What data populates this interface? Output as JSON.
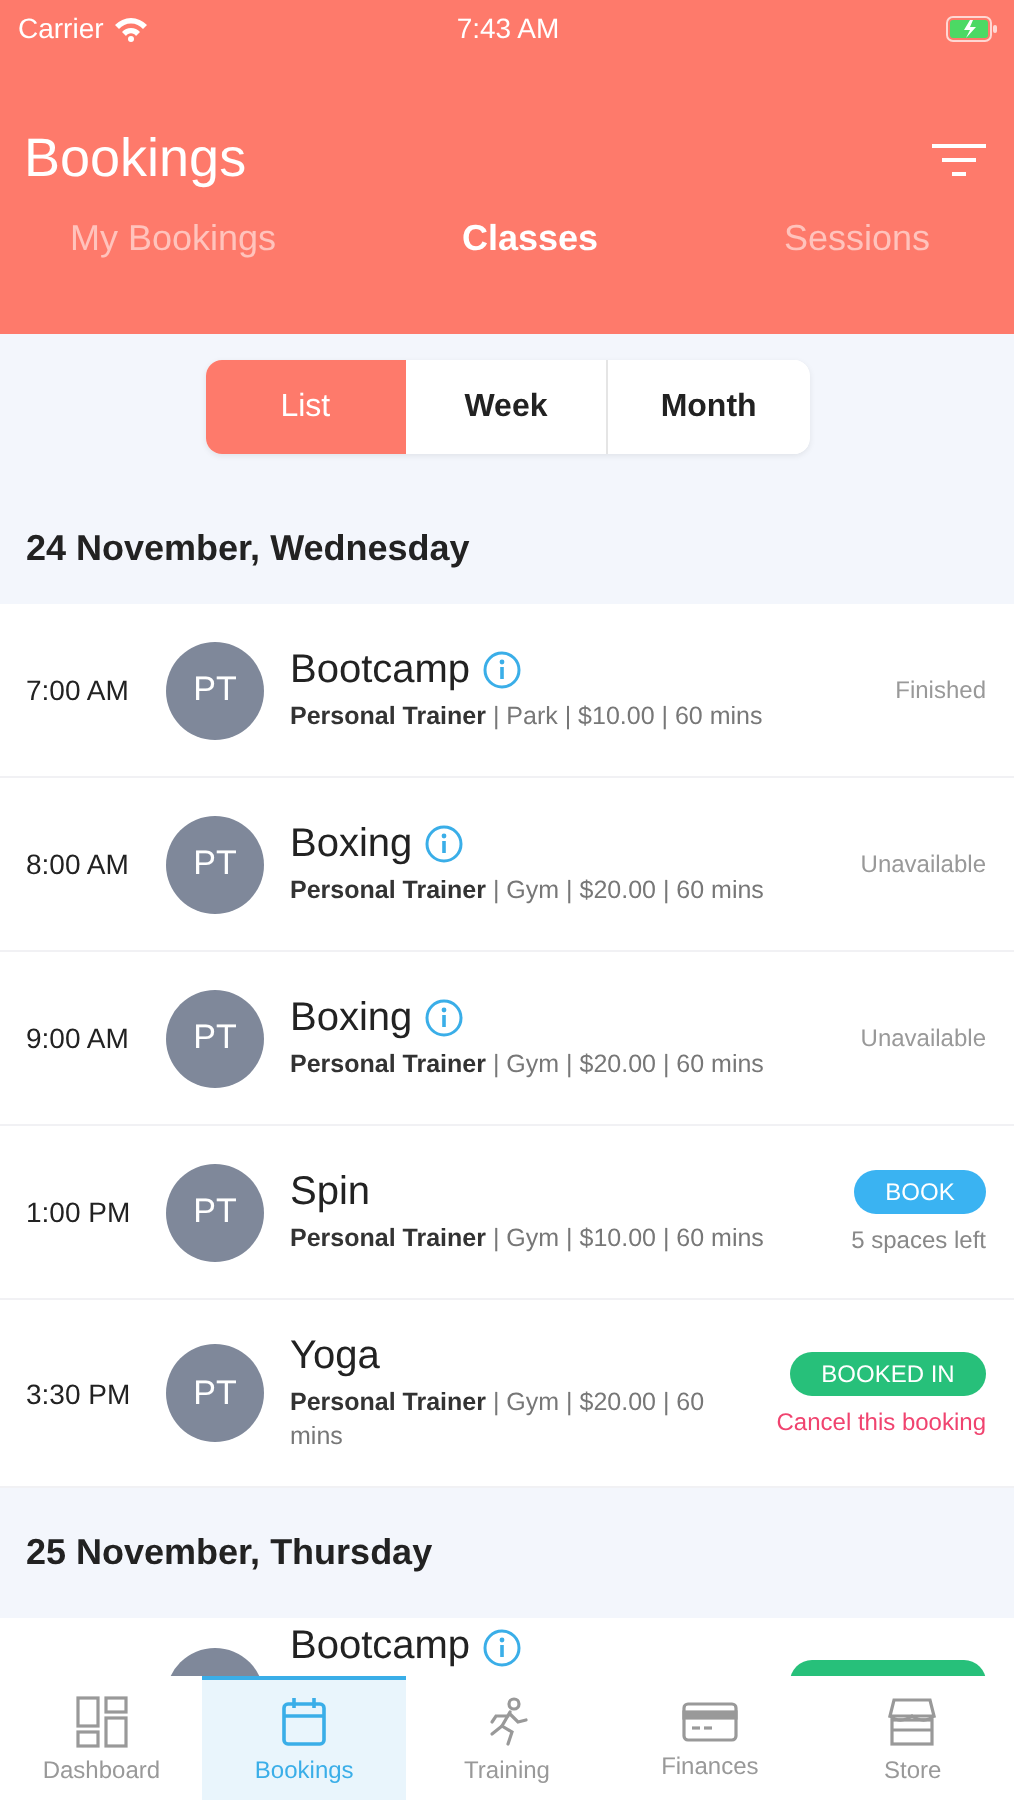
{
  "status_bar": {
    "carrier": "Carrier",
    "time": "7:43 AM"
  },
  "header": {
    "title": "Bookings"
  },
  "tabs": [
    {
      "label": "My Bookings",
      "selected": false
    },
    {
      "label": "Classes",
      "selected": true
    },
    {
      "label": "Sessions",
      "selected": false
    }
  ],
  "view_switch": [
    {
      "label": "List",
      "selected": true
    },
    {
      "label": "Week",
      "selected": false
    },
    {
      "label": "Month",
      "selected": false
    }
  ],
  "days": [
    {
      "date": "24 November, Wednesday",
      "classes": [
        {
          "time": "7:00 AM",
          "avatar": "PT",
          "title": "Bootcamp",
          "info": true,
          "details": "**Personal Trainer** | Park | $10.00 | 60 mins",
          "status": {
            "kind": "text",
            "label": "Finished"
          }
        },
        {
          "time": "8:00 AM",
          "avatar": "PT",
          "title": "Boxing",
          "info": true,
          "details": "**Personal Trainer** | Gym | $20.00 | 60 mins",
          "status": {
            "kind": "text",
            "label": "Unavailable"
          }
        },
        {
          "time": "9:00 AM",
          "avatar": "PT",
          "title": "Boxing",
          "info": true,
          "details": "**Personal Trainer** | Gym | $20.00 | 60 mins",
          "status": {
            "kind": "text",
            "label": "Unavailable"
          }
        },
        {
          "time": "1:00 PM",
          "avatar": "PT",
          "title": "Spin",
          "info": false,
          "details": "**Personal Trainer** | Gym | $10.00 | 60 mins",
          "status": {
            "kind": "book",
            "label": "BOOK",
            "note": "5 spaces left"
          }
        },
        {
          "time": "3:30 PM",
          "avatar": "PT",
          "title": "Yoga",
          "info": false,
          "details": "**Personal Trainer** | Gym | $20.00 | 60 mins",
          "status": {
            "kind": "booked",
            "label": "BOOKED IN",
            "note": "Cancel this booking"
          }
        }
      ]
    },
    {
      "date": "25 November, Thursday",
      "classes": [
        {
          "title": "Bootcamp",
          "info": true,
          "status": {
            "kind": "booked"
          }
        }
      ]
    }
  ],
  "tab_bar": [
    {
      "label": "Dashboard",
      "selected": false
    },
    {
      "label": "Bookings",
      "selected": true
    },
    {
      "label": "Training",
      "selected": false
    },
    {
      "label": "Finances",
      "selected": false
    },
    {
      "label": "Store",
      "selected": false
    }
  ]
}
